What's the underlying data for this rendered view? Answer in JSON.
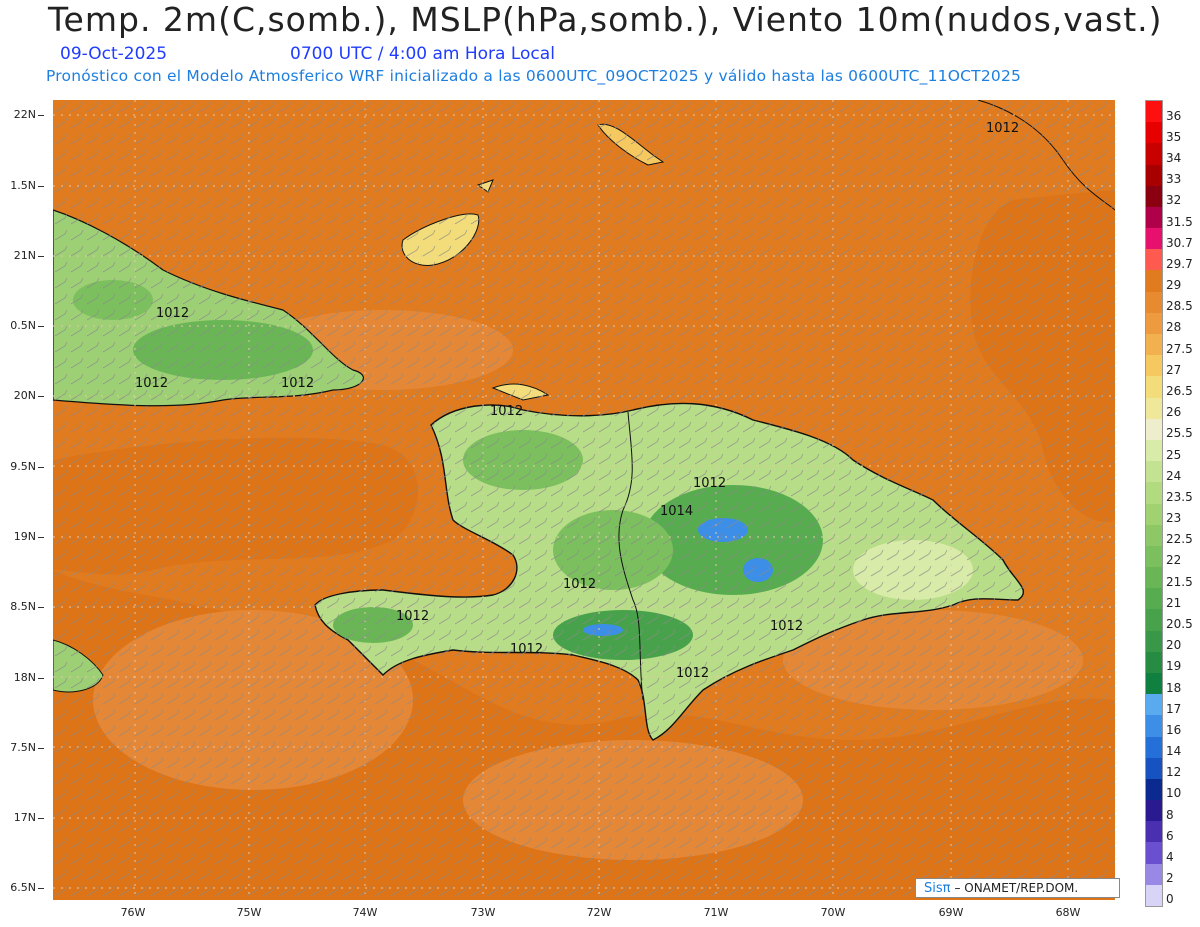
{
  "header": {
    "title": "Temp. 2m(C,somb.), MSLP(hPa,somb.), Viento 10m(nudos,vast.)",
    "date": "09-Oct-2025",
    "time": "0700 UTC / 4:00 am Hora Local",
    "subtitle": "Pronóstico con el Modelo Atmosferico WRF inicializado a las 0600UTC_09OCT2025 y válido hasta las  0600UTC_11OCT2025"
  },
  "axes": {
    "latitudes": [
      "22N",
      "1.5N",
      "21N",
      "0.5N",
      "20N",
      "9.5N",
      "19N",
      "8.5N",
      "18N",
      "7.5N",
      "17N",
      "6.5N"
    ],
    "longitudes": [
      "76W",
      "75W",
      "74W",
      "73W",
      "72W",
      "71W",
      "70W",
      "69W",
      "68W"
    ]
  },
  "isobars": [
    "1012",
    "1012",
    "1012",
    "1012",
    "1012",
    "1012",
    "1014",
    "1012",
    "1012",
    "1012",
    "1012",
    "1012"
  ],
  "colorbar": {
    "labels": [
      "36",
      "35",
      "34",
      "33",
      "32",
      "31.5",
      "30.7",
      "29.7",
      "29",
      "28.5",
      "28",
      "27.5",
      "27",
      "26.5",
      "26",
      "25.5",
      "25",
      "24",
      "23.5",
      "23",
      "22.5",
      "22",
      "21.5",
      "21",
      "20.5",
      "20",
      "19",
      "18",
      "17",
      "16",
      "14",
      "12",
      "10",
      "8",
      "6",
      "4",
      "2",
      "0"
    ],
    "colors": [
      "#ff1010",
      "#e60000",
      "#c80000",
      "#a80000",
      "#8a0010",
      "#b0004a",
      "#e8106e",
      "#ff5a50",
      "#e07b20",
      "#e88a30",
      "#ee9a3e",
      "#f2b04e",
      "#f6c860",
      "#f3dd7a",
      "#efe89a",
      "#eeeecc",
      "#d8eba8",
      "#c4e392",
      "#b2db80",
      "#a0d272",
      "#8ec866",
      "#7cbf5e",
      "#6ab656",
      "#58ac50",
      "#48a24c",
      "#389848",
      "#268c44",
      "#108040",
      "#5aaaf0",
      "#3c8ee6",
      "#2470d8",
      "#1652c0",
      "#0a2a90",
      "#2a1a90",
      "#4a30b0",
      "#6a50d0",
      "#9a88e6",
      "#d8d4f8"
    ]
  },
  "credit": {
    "brand": "Sisπ",
    "text": "– ONAMET/REP.DOM."
  }
}
